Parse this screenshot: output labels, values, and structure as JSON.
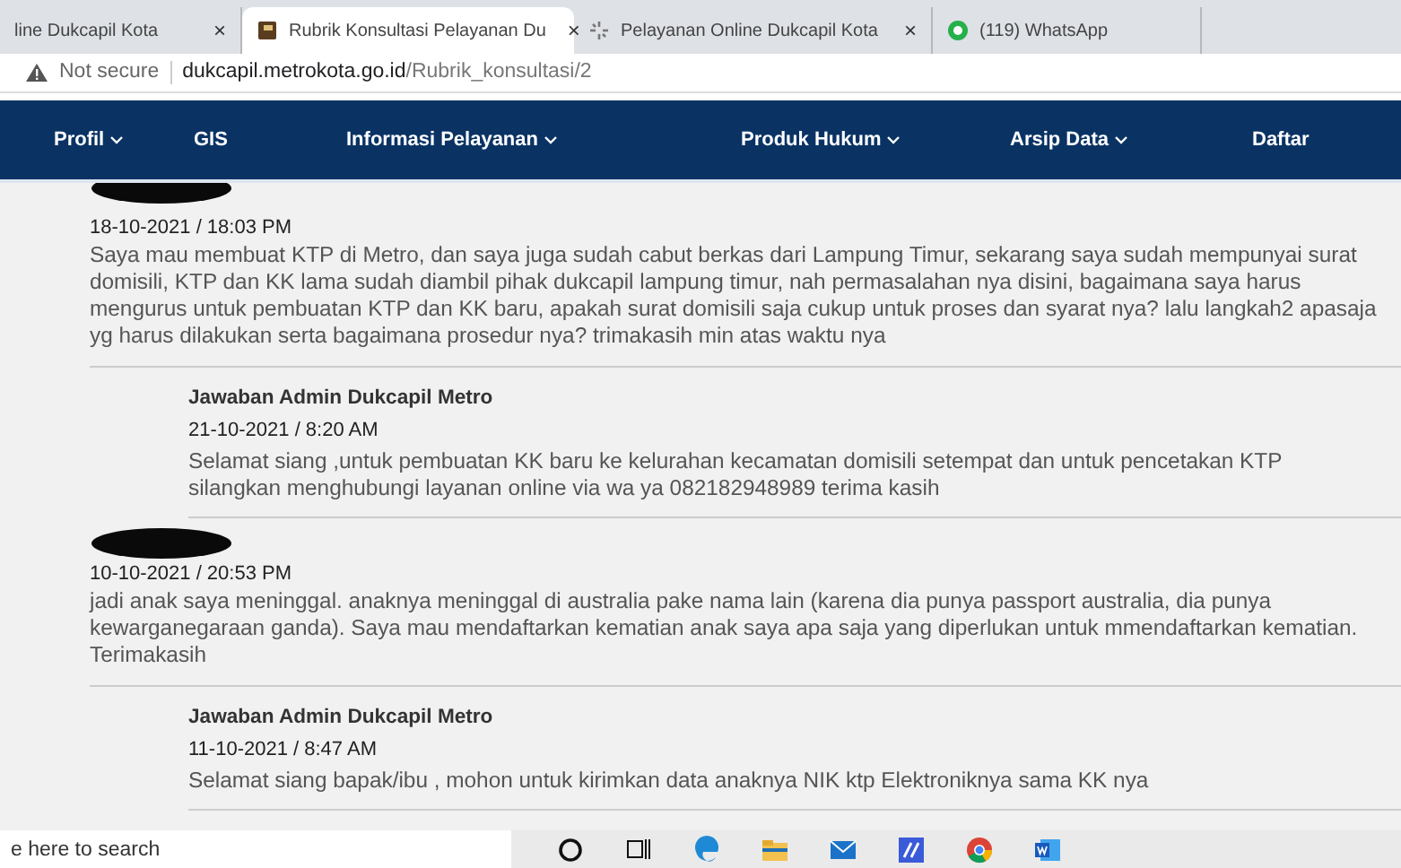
{
  "tabs": [
    {
      "title": "line Dukcapil Kota",
      "close": "×",
      "selected": false,
      "kind": "none"
    },
    {
      "title": "Rubrik Konsultasi Pelayanan Du",
      "close": "×",
      "selected": true,
      "kind": "book"
    },
    {
      "title": "Pelayanan Online Dukcapil Kota",
      "close": "×",
      "selected": false,
      "kind": "loading"
    },
    {
      "title": "(119) WhatsApp",
      "selected": false,
      "kind": "chat"
    }
  ],
  "address": {
    "security": "Not secure",
    "host": "dukcapil.metrokota.go.id",
    "path": "/Rubrik_konsultasi/2"
  },
  "nav": [
    {
      "label": "Profil",
      "dropdown": true
    },
    {
      "label": "GIS",
      "dropdown": false
    },
    {
      "label": "Informasi Pelayanan",
      "dropdown": true
    },
    {
      "label": "Produk Hukum",
      "dropdown": true
    },
    {
      "label": "Arsip Data",
      "dropdown": true
    },
    {
      "label": "Daftar",
      "dropdown": false
    }
  ],
  "posts": [
    {
      "redacted": true,
      "date": "18-10-2021 / 18:03 PM",
      "message": "Saya mau membuat KTP di Metro, dan saya juga sudah cabut berkas dari Lampung Timur, sekarang saya sudah mempunyai surat domisili, KTP dan KK lama sudah diambil pihak dukcapil lampung timur, nah permasalahan nya disini, bagaimana saya harus mengurus untuk pembuatan KTP dan KK baru, apakah surat domisili saja cukup untuk proses dan syarat nya? lalu langkah2 apasaja yg harus dilakukan serta bagaimana prosedur nya? trimakasih min atas waktu nya",
      "replies": [
        {
          "author": "Jawaban Admin Dukcapil Metro",
          "date": "21-10-2021 / 8:20 AM",
          "message": "Selamat siang ,untuk pembuatan KK baru ke kelurahan kecamatan domisili setempat dan untuk pencetakan KTP silangkan menghubungi layanan online via wa ya 082182948989 terima kasih"
        }
      ]
    },
    {
      "redacted": true,
      "date": "10-10-2021 / 20:53 PM",
      "message": "jadi anak saya meninggal. anaknya meninggal di australia pake nama lain (karena dia punya passport australia, dia punya kewarganegaraan ganda). Saya mau mendaftarkan kematian anak saya apa saja yang diperlukan untuk mmendaftarkan kematian. Terimakasih",
      "replies": [
        {
          "author": "Jawaban Admin Dukcapil Metro",
          "date": "11-10-2021 / 8:47 AM",
          "message": "Selamat siang bapak/ibu , mohon untuk kirimkan data anaknya NIK ktp Elektroniknya  sama KK nya"
        }
      ]
    }
  ],
  "taskbar": {
    "search_placeholder": "e here to search",
    "apps": [
      {
        "kind": "cortana"
      },
      {
        "kind": "taskview"
      },
      {
        "kind": "edge"
      },
      {
        "kind": "folder"
      },
      {
        "kind": "mail"
      },
      {
        "kind": "editor"
      },
      {
        "kind": "chrome"
      },
      {
        "kind": "word"
      }
    ]
  }
}
